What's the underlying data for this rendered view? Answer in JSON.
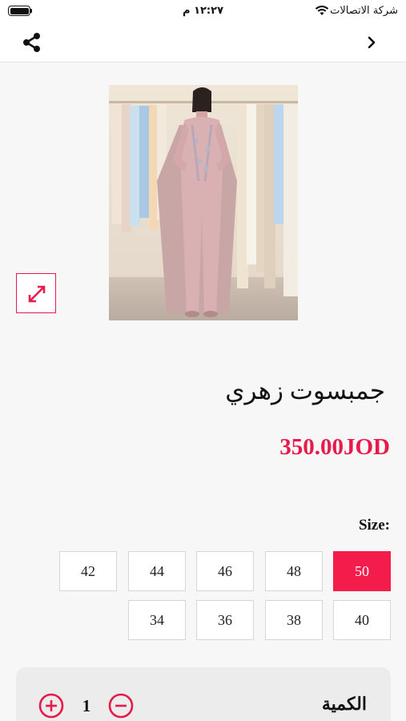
{
  "status_bar": {
    "carrier": "شركة الاتصالات",
    "time": "١٢:٢٧ م"
  },
  "nav": {
    "share_icon": "share-icon",
    "back_icon": "chevron-right-icon"
  },
  "product": {
    "title": "جمبسوت زهري",
    "price": "350.00JOD",
    "image_alt": "Pink jumpsuit with cape"
  },
  "size": {
    "label": "Size:",
    "selected": "50",
    "row1": [
      "50",
      "48",
      "46",
      "44",
      "42"
    ],
    "row2": [
      "40",
      "38",
      "36",
      "34"
    ]
  },
  "quantity": {
    "label": "الكمية",
    "value": "1"
  },
  "colors": {
    "accent": "#f41c4b",
    "background": "#f7f7f7"
  }
}
